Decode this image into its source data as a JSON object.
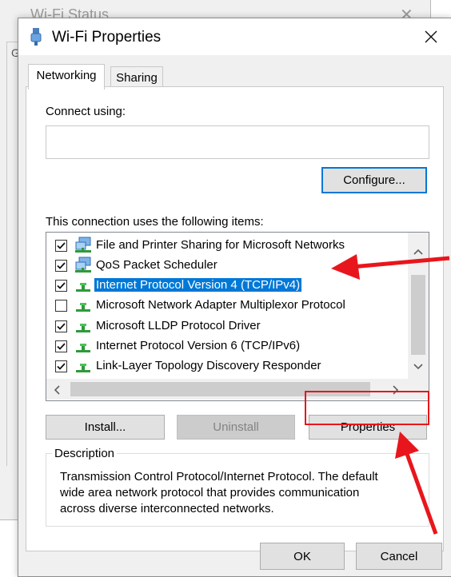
{
  "background_window": {
    "title": "Wi-Fi Status",
    "fragment_label": "G"
  },
  "dialog": {
    "title": "Wi-Fi Properties"
  },
  "tabs": [
    {
      "label": "Networking",
      "active": true
    },
    {
      "label": "Sharing",
      "active": false
    }
  ],
  "connect_using": {
    "label": "Connect using:",
    "adapter_value": ""
  },
  "configure_button": "Configure...",
  "items_label": "This connection uses the following items:",
  "items": [
    {
      "label": "File and Printer Sharing for Microsoft Networks",
      "checked": true,
      "icon": "network-service-icon",
      "selected": false
    },
    {
      "label": "QoS Packet Scheduler",
      "checked": true,
      "icon": "network-service-icon",
      "selected": false
    },
    {
      "label": "Internet Protocol Version 4 (TCP/IPv4)",
      "checked": true,
      "icon": "protocol-icon",
      "selected": true
    },
    {
      "label": "Microsoft Network Adapter Multiplexor Protocol",
      "checked": false,
      "icon": "protocol-icon",
      "selected": false
    },
    {
      "label": "Microsoft LLDP Protocol Driver",
      "checked": true,
      "icon": "protocol-icon",
      "selected": false
    },
    {
      "label": "Internet Protocol Version 6 (TCP/IPv6)",
      "checked": true,
      "icon": "protocol-icon",
      "selected": false
    },
    {
      "label": "Link-Layer Topology Discovery Responder",
      "checked": true,
      "icon": "protocol-icon",
      "selected": false
    }
  ],
  "buttons": {
    "install": "Install...",
    "uninstall": "Uninstall",
    "properties": "Properties",
    "ok": "OK",
    "cancel": "Cancel"
  },
  "description": {
    "legend": "Description",
    "lines": [
      "Transmission Control Protocol/Internet Protocol. The default",
      "wide area network protocol that provides communication",
      "across diverse interconnected networks."
    ]
  },
  "colors": {
    "selection": "#0078d7",
    "annotation": "#e8161c",
    "dialog_bg": "#f0f0f0"
  }
}
